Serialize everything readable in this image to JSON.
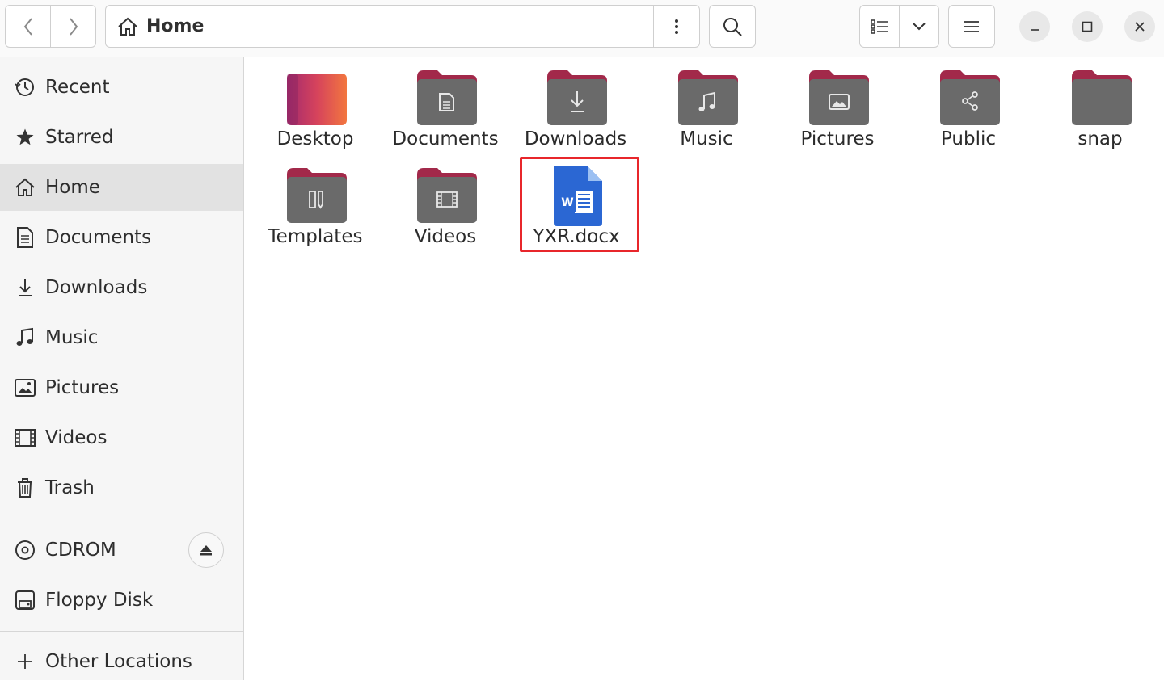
{
  "window": {
    "location": "Home",
    "path_icon": "home-icon"
  },
  "header": {
    "back_icon": "back-arrow-icon",
    "forward_icon": "forward-arrow-icon",
    "path_menu_icon": "vertical-dots-icon",
    "search_icon": "search-icon",
    "view_list_icon": "list-view-icon",
    "view_options_icon": "chevron-down-icon",
    "main_menu_icon": "hamburger-icon",
    "minimize_icon": "minimize-icon",
    "maximize_icon": "maximize-icon",
    "close_icon": "close-icon"
  },
  "sidebar": {
    "items": [
      {
        "label": "Recent",
        "icon": "clock-icon"
      },
      {
        "label": "Starred",
        "icon": "star-icon"
      },
      {
        "label": "Home",
        "icon": "home-icon",
        "active": true
      },
      {
        "label": "Documents",
        "icon": "document-icon"
      },
      {
        "label": "Downloads",
        "icon": "download-icon"
      },
      {
        "label": "Music",
        "icon": "music-note-icon"
      },
      {
        "label": "Pictures",
        "icon": "picture-icon"
      },
      {
        "label": "Videos",
        "icon": "film-icon"
      },
      {
        "label": "Trash",
        "icon": "trash-icon"
      }
    ],
    "devices": [
      {
        "label": "CDROM",
        "icon": "disc-icon",
        "eject_icon": "eject-icon"
      },
      {
        "label": "Floppy Disk",
        "icon": "drive-icon"
      }
    ],
    "other": {
      "label": "Other Locations",
      "icon": "plus-icon"
    }
  },
  "files": [
    {
      "name": "Desktop",
      "type": "folder",
      "emblem": "desktop"
    },
    {
      "name": "Documents",
      "type": "folder",
      "emblem": "document"
    },
    {
      "name": "Downloads",
      "type": "folder",
      "emblem": "download"
    },
    {
      "name": "Music",
      "type": "folder",
      "emblem": "music"
    },
    {
      "name": "Pictures",
      "type": "folder",
      "emblem": "picture"
    },
    {
      "name": "Public",
      "type": "folder",
      "emblem": "share"
    },
    {
      "name": "snap",
      "type": "folder",
      "emblem": "none"
    },
    {
      "name": "Templates",
      "type": "folder",
      "emblem": "template"
    },
    {
      "name": "Videos",
      "type": "folder",
      "emblem": "film"
    },
    {
      "name": "YXR.docx",
      "type": "docx",
      "highlighted": true
    }
  ],
  "colors": {
    "folder_body": "#6a6a6a",
    "folder_tab": "#a2294a",
    "highlight": "#e8262b",
    "word_blue": "#2b67d3"
  }
}
